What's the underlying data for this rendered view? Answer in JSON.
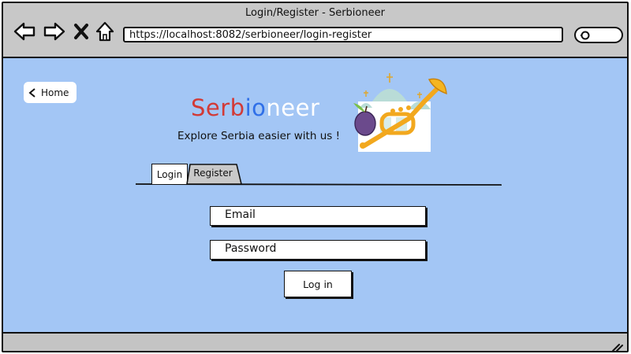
{
  "window": {
    "title": "Login/Register - Serbioneer"
  },
  "toolbar": {
    "url": "https://localhost:8082/serbioneer/login-register",
    "icons": [
      "back-icon",
      "forward-icon",
      "stop-icon",
      "home-icon",
      "search-icon"
    ]
  },
  "page": {
    "home_label": "Home",
    "brand": {
      "part1": "Serb",
      "part2": "io",
      "part3": "neer"
    },
    "tagline": "Explore Serbia easier with us !",
    "tabs": [
      {
        "label": "Login",
        "active": true
      },
      {
        "label": "Register",
        "active": false
      }
    ],
    "form": {
      "email_placeholder": "Email",
      "password_placeholder": "Password",
      "submit_label": "Log in"
    }
  },
  "colors": {
    "content_bg": "#a3c6f5",
    "brand_red": "#d23a36",
    "brand_blue": "#2f6fe8",
    "brand_white": "#ffffff",
    "chrome": "#c8c8c8"
  }
}
